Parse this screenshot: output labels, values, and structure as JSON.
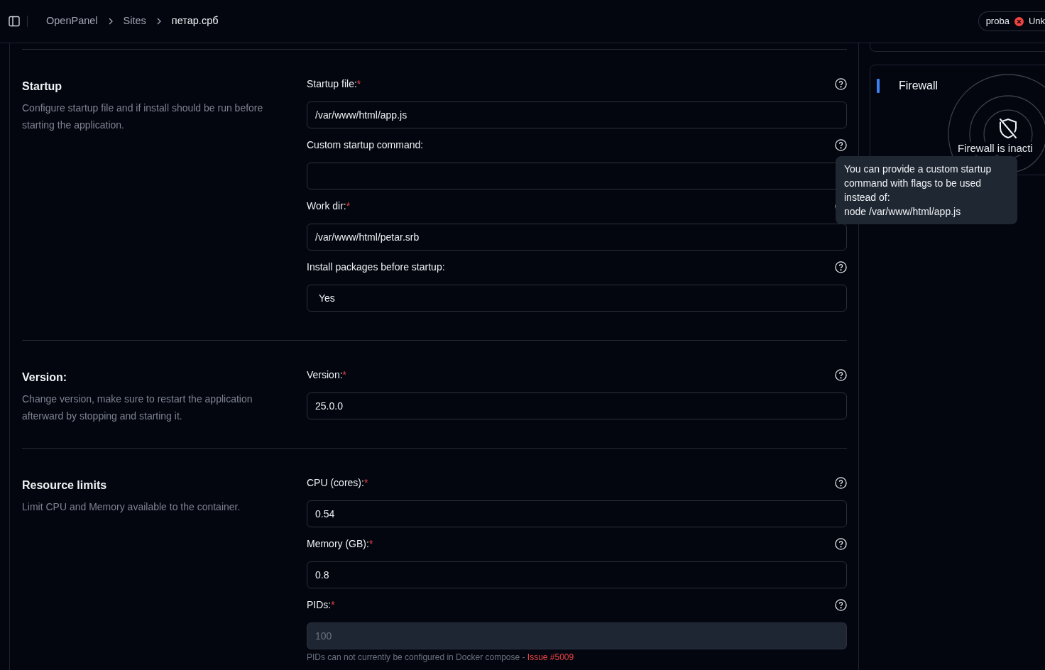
{
  "topbar": {
    "breadcrumbs": [
      {
        "label": "OpenPanel",
        "current": false
      },
      {
        "label": "Sites",
        "current": false
      },
      {
        "label": "петар.срб",
        "current": true
      }
    ],
    "account": {
      "name": "proba",
      "status": "Unk"
    }
  },
  "sections": [
    {
      "title": "Startup",
      "description": "Configure startup file and if install should be run before starting the application.",
      "fields": [
        {
          "kind": "text",
          "label": "Startup file:",
          "required_mark": "*",
          "value": "/var/www/html/app.js",
          "disabled": false
        },
        {
          "kind": "text",
          "label": "Custom startup command:",
          "disabled": false
        },
        {
          "kind": "text",
          "label": "Work dir:",
          "required_mark": "*",
          "value": "/var/www/html/petar.srb",
          "disabled": false
        },
        {
          "kind": "select",
          "label": "Install packages before startup:",
          "value": "Yes",
          "disabled": false
        }
      ]
    },
    {
      "title": "Version:",
      "description": "Change version, make sure to restart the application afterward by stopping and starting it.",
      "fields": [
        {
          "kind": "text",
          "label": "Version:",
          "required_mark": "*",
          "value": "25.0.0",
          "disabled": false
        }
      ]
    },
    {
      "title": "Resource limits",
      "description": "Limit CPU and Memory available to the container.",
      "fields": [
        {
          "kind": "text",
          "label": "CPU (cores):",
          "required_mark": "*",
          "value": "0.54",
          "disabled": false
        },
        {
          "kind": "text",
          "label": "Memory (GB):",
          "required_mark": "*",
          "value": "0.8",
          "disabled": false
        },
        {
          "kind": "text",
          "label": "PIDs:",
          "required_mark": "*",
          "placeholder": "100",
          "disabled": true,
          "note": "PIDs can not currently be configured in Docker compose - ",
          "note_link": "Issue #5009"
        }
      ]
    }
  ],
  "sidebar": {
    "firewall": {
      "title": "Firewall",
      "status": "Firewall is inacti"
    }
  },
  "tooltip": {
    "text": "You can provide a custom startup\ncommand with flags to be used\ninstead of:\nnode /var/www/html/app.js"
  }
}
